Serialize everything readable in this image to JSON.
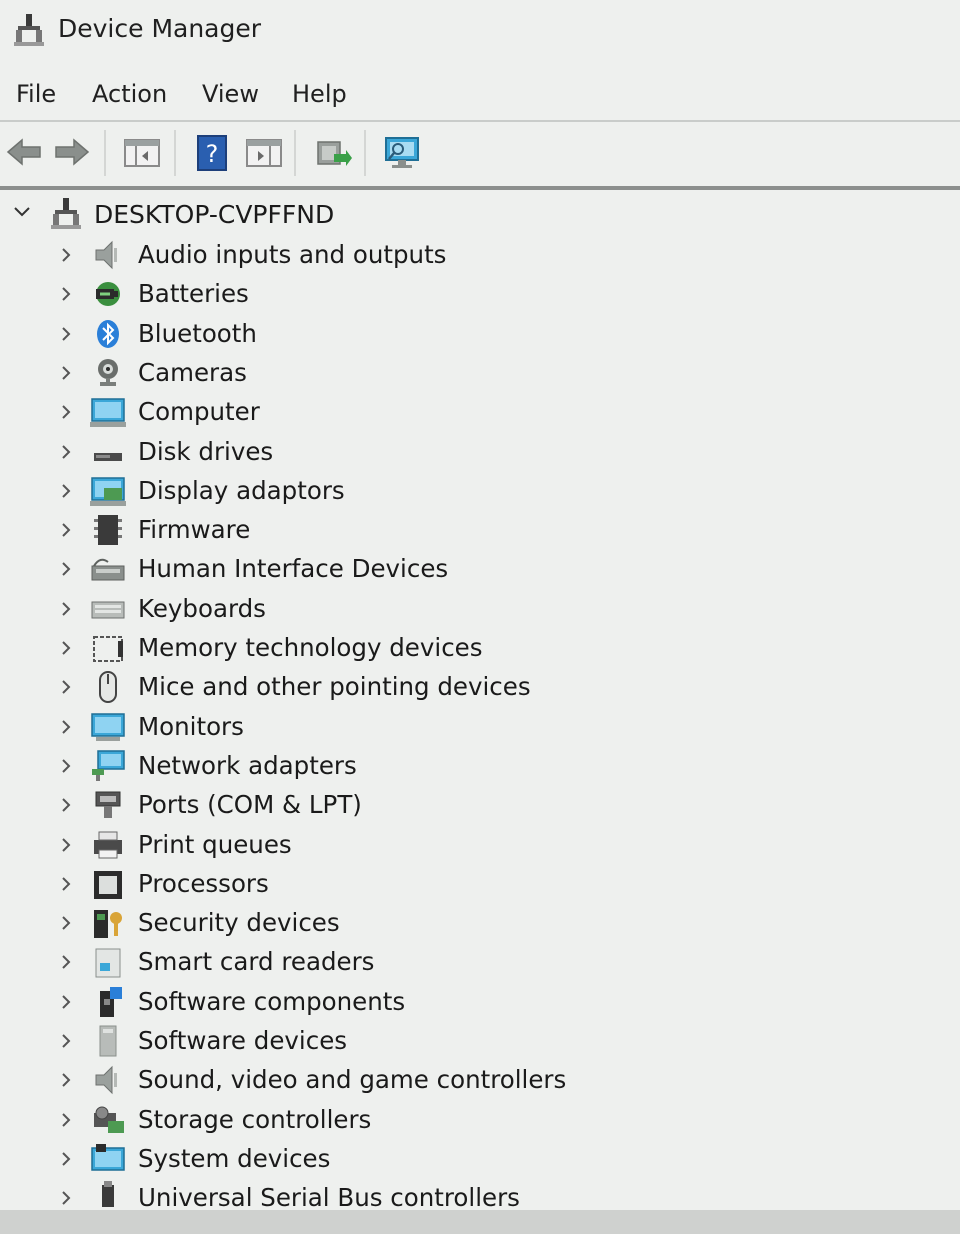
{
  "window": {
    "title": "Device Manager"
  },
  "menu": {
    "items": [
      "File",
      "Action",
      "View",
      "Help"
    ]
  },
  "tree": {
    "root": "DESKTOP-CVPFFND",
    "categories": [
      {
        "label": "Audio inputs and outputs",
        "icon": "speaker-icon"
      },
      {
        "label": "Batteries",
        "icon": "battery-icon"
      },
      {
        "label": "Bluetooth",
        "icon": "bluetooth-icon"
      },
      {
        "label": "Cameras",
        "icon": "camera-icon"
      },
      {
        "label": "Computer",
        "icon": "computer-icon"
      },
      {
        "label": "Disk drives",
        "icon": "disk-drive-icon"
      },
      {
        "label": "Display adaptors",
        "icon": "display-adapter-icon"
      },
      {
        "label": "Firmware",
        "icon": "firmware-icon"
      },
      {
        "label": "Human Interface Devices",
        "icon": "hid-icon"
      },
      {
        "label": "Keyboards",
        "icon": "keyboard-icon"
      },
      {
        "label": "Memory technology devices",
        "icon": "memory-icon"
      },
      {
        "label": "Mice and other pointing devices",
        "icon": "mouse-icon"
      },
      {
        "label": "Monitors",
        "icon": "monitor-icon"
      },
      {
        "label": "Network adapters",
        "icon": "network-adapter-icon"
      },
      {
        "label": "Ports (COM & LPT)",
        "icon": "port-icon"
      },
      {
        "label": "Print queues",
        "icon": "printer-icon"
      },
      {
        "label": "Processors",
        "icon": "processor-icon"
      },
      {
        "label": "Security devices",
        "icon": "security-device-icon"
      },
      {
        "label": "Smart card readers",
        "icon": "smart-card-reader-icon"
      },
      {
        "label": "Software components",
        "icon": "software-component-icon"
      },
      {
        "label": "Software devices",
        "icon": "software-device-icon"
      },
      {
        "label": "Sound, video and game controllers",
        "icon": "sound-controller-icon"
      },
      {
        "label": "Storage controllers",
        "icon": "storage-controller-icon"
      },
      {
        "label": "System devices",
        "icon": "system-devices-icon"
      },
      {
        "label": "Universal Serial Bus controllers",
        "icon": "usb-icon"
      }
    ]
  },
  "colors": {
    "background": "#eef0ee",
    "accent_blue": "#2a7fd8",
    "text": "#1b1b1b"
  }
}
